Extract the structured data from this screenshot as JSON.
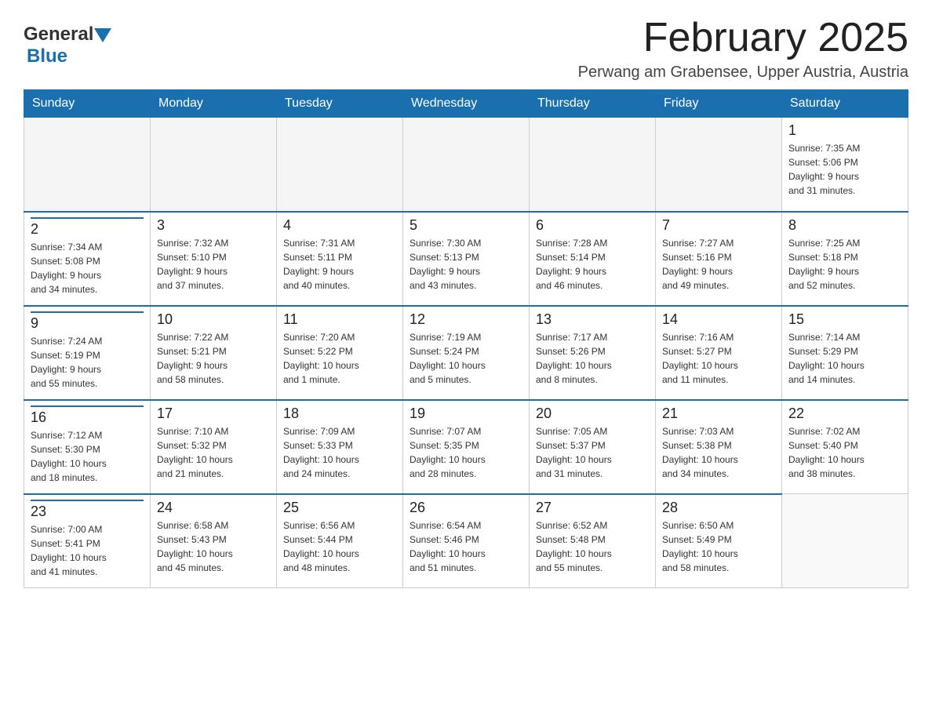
{
  "header": {
    "logo_general": "General",
    "logo_blue": "Blue",
    "title": "February 2025",
    "subtitle": "Perwang am Grabensee, Upper Austria, Austria"
  },
  "weekdays": [
    "Sunday",
    "Monday",
    "Tuesday",
    "Wednesday",
    "Thursday",
    "Friday",
    "Saturday"
  ],
  "weeks": [
    [
      {
        "day": "",
        "info": ""
      },
      {
        "day": "",
        "info": ""
      },
      {
        "day": "",
        "info": ""
      },
      {
        "day": "",
        "info": ""
      },
      {
        "day": "",
        "info": ""
      },
      {
        "day": "",
        "info": ""
      },
      {
        "day": "1",
        "info": "Sunrise: 7:35 AM\nSunset: 5:06 PM\nDaylight: 9 hours\nand 31 minutes."
      }
    ],
    [
      {
        "day": "2",
        "info": "Sunrise: 7:34 AM\nSunset: 5:08 PM\nDaylight: 9 hours\nand 34 minutes."
      },
      {
        "day": "3",
        "info": "Sunrise: 7:32 AM\nSunset: 5:10 PM\nDaylight: 9 hours\nand 37 minutes."
      },
      {
        "day": "4",
        "info": "Sunrise: 7:31 AM\nSunset: 5:11 PM\nDaylight: 9 hours\nand 40 minutes."
      },
      {
        "day": "5",
        "info": "Sunrise: 7:30 AM\nSunset: 5:13 PM\nDaylight: 9 hours\nand 43 minutes."
      },
      {
        "day": "6",
        "info": "Sunrise: 7:28 AM\nSunset: 5:14 PM\nDaylight: 9 hours\nand 46 minutes."
      },
      {
        "day": "7",
        "info": "Sunrise: 7:27 AM\nSunset: 5:16 PM\nDaylight: 9 hours\nand 49 minutes."
      },
      {
        "day": "8",
        "info": "Sunrise: 7:25 AM\nSunset: 5:18 PM\nDaylight: 9 hours\nand 52 minutes."
      }
    ],
    [
      {
        "day": "9",
        "info": "Sunrise: 7:24 AM\nSunset: 5:19 PM\nDaylight: 9 hours\nand 55 minutes."
      },
      {
        "day": "10",
        "info": "Sunrise: 7:22 AM\nSunset: 5:21 PM\nDaylight: 9 hours\nand 58 minutes."
      },
      {
        "day": "11",
        "info": "Sunrise: 7:20 AM\nSunset: 5:22 PM\nDaylight: 10 hours\nand 1 minute."
      },
      {
        "day": "12",
        "info": "Sunrise: 7:19 AM\nSunset: 5:24 PM\nDaylight: 10 hours\nand 5 minutes."
      },
      {
        "day": "13",
        "info": "Sunrise: 7:17 AM\nSunset: 5:26 PM\nDaylight: 10 hours\nand 8 minutes."
      },
      {
        "day": "14",
        "info": "Sunrise: 7:16 AM\nSunset: 5:27 PM\nDaylight: 10 hours\nand 11 minutes."
      },
      {
        "day": "15",
        "info": "Sunrise: 7:14 AM\nSunset: 5:29 PM\nDaylight: 10 hours\nand 14 minutes."
      }
    ],
    [
      {
        "day": "16",
        "info": "Sunrise: 7:12 AM\nSunset: 5:30 PM\nDaylight: 10 hours\nand 18 minutes."
      },
      {
        "day": "17",
        "info": "Sunrise: 7:10 AM\nSunset: 5:32 PM\nDaylight: 10 hours\nand 21 minutes."
      },
      {
        "day": "18",
        "info": "Sunrise: 7:09 AM\nSunset: 5:33 PM\nDaylight: 10 hours\nand 24 minutes."
      },
      {
        "day": "19",
        "info": "Sunrise: 7:07 AM\nSunset: 5:35 PM\nDaylight: 10 hours\nand 28 minutes."
      },
      {
        "day": "20",
        "info": "Sunrise: 7:05 AM\nSunset: 5:37 PM\nDaylight: 10 hours\nand 31 minutes."
      },
      {
        "day": "21",
        "info": "Sunrise: 7:03 AM\nSunset: 5:38 PM\nDaylight: 10 hours\nand 34 minutes."
      },
      {
        "day": "22",
        "info": "Sunrise: 7:02 AM\nSunset: 5:40 PM\nDaylight: 10 hours\nand 38 minutes."
      }
    ],
    [
      {
        "day": "23",
        "info": "Sunrise: 7:00 AM\nSunset: 5:41 PM\nDaylight: 10 hours\nand 41 minutes."
      },
      {
        "day": "24",
        "info": "Sunrise: 6:58 AM\nSunset: 5:43 PM\nDaylight: 10 hours\nand 45 minutes."
      },
      {
        "day": "25",
        "info": "Sunrise: 6:56 AM\nSunset: 5:44 PM\nDaylight: 10 hours\nand 48 minutes."
      },
      {
        "day": "26",
        "info": "Sunrise: 6:54 AM\nSunset: 5:46 PM\nDaylight: 10 hours\nand 51 minutes."
      },
      {
        "day": "27",
        "info": "Sunrise: 6:52 AM\nSunset: 5:48 PM\nDaylight: 10 hours\nand 55 minutes."
      },
      {
        "day": "28",
        "info": "Sunrise: 6:50 AM\nSunset: 5:49 PM\nDaylight: 10 hours\nand 58 minutes."
      },
      {
        "day": "",
        "info": ""
      }
    ]
  ]
}
